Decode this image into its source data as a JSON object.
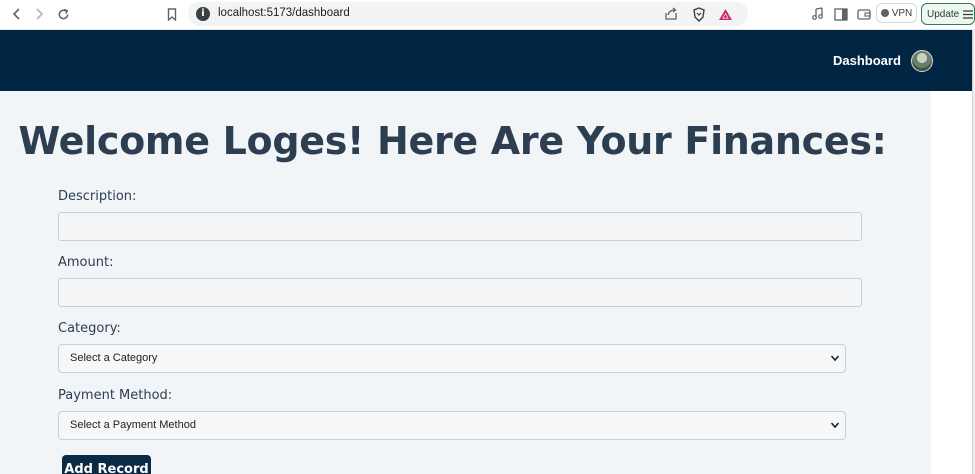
{
  "browser": {
    "url": "localhost:5173/dashboard",
    "vpn_label": "VPN",
    "update_label": "Update"
  },
  "header": {
    "title": "Dashboard"
  },
  "main": {
    "welcome": "Welcome Loges! Here Are Your Finances:",
    "description_label": "Description:",
    "description_value": "",
    "amount_label": "Amount:",
    "amount_value": "",
    "category_label": "Category:",
    "category_selected": "Select a Category",
    "payment_label": "Payment Method:",
    "payment_selected": "Select a Payment Method",
    "add_button": "Add Record"
  },
  "colors": {
    "header_bg": "#002644",
    "page_bg": "#f2f5f8",
    "button_bg": "#0b2a45",
    "heading": "#2c3e50"
  }
}
